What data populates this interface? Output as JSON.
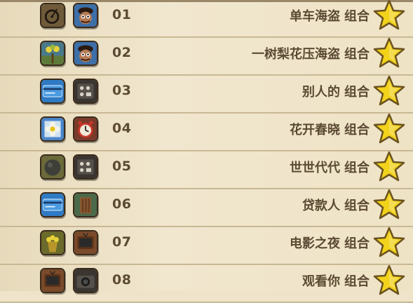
{
  "combos": [
    {
      "number": "01",
      "name": "单车海盗",
      "suffix": "组合",
      "icons": [
        "bicycle-wheel-icon",
        "pirate-doll-icon"
      ],
      "completed": true
    },
    {
      "number": "02",
      "name": "一树梨花压海盗",
      "suffix": "组合",
      "icons": [
        "pear-tree-icon",
        "pirate-doll-icon"
      ],
      "completed": true
    },
    {
      "number": "03",
      "name": "别人的",
      "suffix": "组合",
      "icons": [
        "credit-card-icon",
        "control-panel-icon"
      ],
      "completed": true
    },
    {
      "number": "04",
      "name": "花开春晓",
      "suffix": "组合",
      "icons": [
        "flower-icon",
        "alarm-clock-icon"
      ],
      "completed": true
    },
    {
      "number": "05",
      "name": "世世代代",
      "suffix": "组合",
      "icons": [
        "stone-ball-icon",
        "control-panel-icon"
      ],
      "completed": true
    },
    {
      "number": "06",
      "name": "贷款人",
      "suffix": "组合",
      "icons": [
        "credit-card-icon",
        "wooden-chair-icon"
      ],
      "completed": true
    },
    {
      "number": "07",
      "name": "电影之夜",
      "suffix": "组合",
      "icons": [
        "popcorn-icon",
        "retro-tv-icon"
      ],
      "completed": true
    },
    {
      "number": "08",
      "name": "观看你",
      "suffix": "组合",
      "icons": [
        "retro-tv-icon",
        "camera-icon"
      ],
      "completed": true
    }
  ],
  "colors": {
    "paper": "#efe4c9",
    "text": "#5b4a34",
    "star": "#f2d21a",
    "star_outline": "#6b5320"
  }
}
